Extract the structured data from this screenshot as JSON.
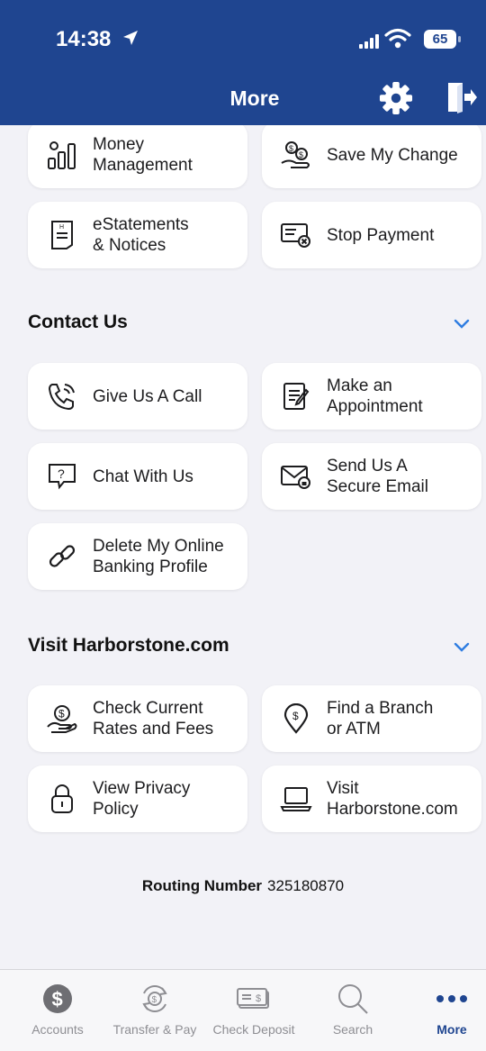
{
  "status_bar": {
    "time": "14:38",
    "battery": "65"
  },
  "header": {
    "title": "More"
  },
  "top_cards": [
    {
      "label": "Money\nManagement",
      "icon": "chart-bars-icon"
    },
    {
      "label": "Save My Change",
      "icon": "coins-icon"
    },
    {
      "label": "eStatements\n& Notices",
      "icon": "document-icon"
    },
    {
      "label": "Stop Payment",
      "icon": "check-cancel-icon"
    }
  ],
  "contact": {
    "title": "Contact Us",
    "cards": [
      {
        "label": "Give Us A Call",
        "icon": "phone-icon"
      },
      {
        "label": "Make an\nAppointment",
        "icon": "notepad-icon"
      },
      {
        "label": "Chat With Us",
        "icon": "chat-icon"
      },
      {
        "label": "Send Us A\nSecure Email",
        "icon": "secure-email-icon"
      },
      {
        "label": "Delete My Online\nBanking Profile",
        "icon": "link-icon"
      }
    ]
  },
  "visit": {
    "title": "Visit Harborstone.com",
    "cards": [
      {
        "label": "Check Current\nRates and Fees",
        "icon": "money-hand-icon"
      },
      {
        "label": "Find a Branch\nor ATM",
        "icon": "location-pin-icon"
      },
      {
        "label": "View Privacy\nPolicy",
        "icon": "lock-icon"
      },
      {
        "label": "Visit\nHarborstone.com",
        "icon": "laptop-icon"
      }
    ]
  },
  "routing": {
    "label": "Routing Number",
    "value": "325180870"
  },
  "tabs": [
    {
      "label": "Accounts",
      "icon": "dollar-circle-icon"
    },
    {
      "label": "Transfer & Pay",
      "icon": "transfer-icon"
    },
    {
      "label": "Check Deposit",
      "icon": "check-icon"
    },
    {
      "label": "Search",
      "icon": "search-icon"
    },
    {
      "label": "More",
      "icon": "more-dots-icon",
      "active": true
    }
  ],
  "colors": {
    "brand": "#1f4590",
    "chevron": "#2f7de1",
    "tab_inactive": "#8e8e93"
  }
}
